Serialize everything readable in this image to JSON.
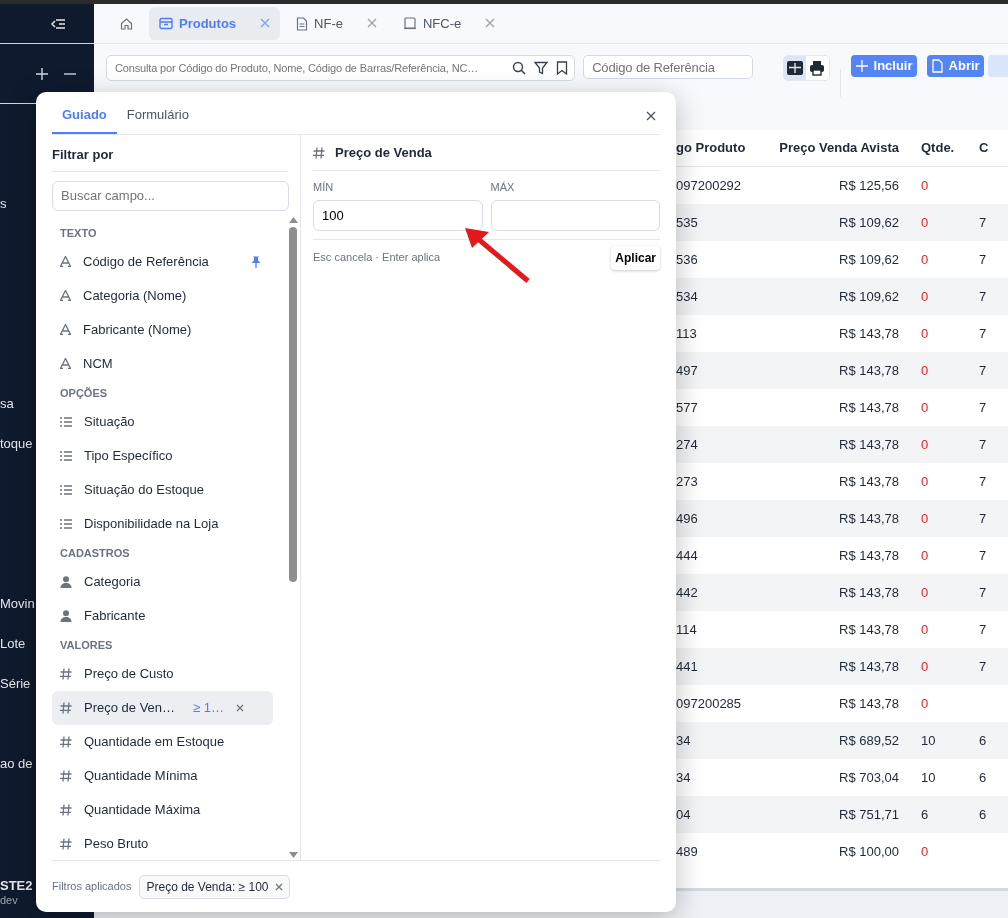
{
  "sidebar": {
    "groups": [
      [
        "s"
      ],
      [
        "sa",
        "toque"
      ],
      [
        "Movin",
        "Lote",
        "Série"
      ],
      [
        "ao de"
      ]
    ],
    "user": "STE2",
    "env": "dev"
  },
  "tabs": [
    {
      "label": "Produtos",
      "selected": true
    },
    {
      "label": "NF-e",
      "selected": false
    },
    {
      "label": "NFC-e",
      "selected": false
    }
  ],
  "toolbar": {
    "search_placeholder": "Consulta por Código do Produto, Nome, Código de Barras/Referência, NC…",
    "reference_placeholder": "Código de Referência",
    "grid_view_selected": true,
    "buttons": [
      "Incluir",
      "Abrir"
    ]
  },
  "table": {
    "columns": [
      "go Produto",
      "Preço Venda Avista",
      "Qtde.",
      "C"
    ],
    "rows": [
      {
        "code": "097200292",
        "price": "R$ 125,56",
        "qty": "0",
        "qty_alert": true
      },
      {
        "code": "535",
        "price": "R$ 109,62",
        "qty": "0",
        "qty_alert": true,
        "column_4": "7"
      },
      {
        "code": "536",
        "price": "R$ 109,62",
        "qty": "0",
        "qty_alert": true,
        "column_4": "7"
      },
      {
        "code": "534",
        "price": "R$ 109,62",
        "qty": "0",
        "qty_alert": true,
        "column_4": "7"
      },
      {
        "code": "113",
        "price": "R$ 143,78",
        "qty": "0",
        "qty_alert": true,
        "column_4": "7"
      },
      {
        "code": "497",
        "price": "R$ 143,78",
        "qty": "0",
        "qty_alert": true,
        "column_4": "7"
      },
      {
        "code": "577",
        "price": "R$ 143,78",
        "qty": "0",
        "qty_alert": true,
        "column_4": "7"
      },
      {
        "code": "274",
        "price": "R$ 143,78",
        "qty": "0",
        "qty_alert": true,
        "column_4": "7"
      },
      {
        "code": "273",
        "price": "R$ 143,78",
        "qty": "0",
        "qty_alert": true,
        "column_4": "7"
      },
      {
        "code": "496",
        "price": "R$ 143,78",
        "qty": "0",
        "qty_alert": true,
        "column_4": "7"
      },
      {
        "code": "444",
        "price": "R$ 143,78",
        "qty": "0",
        "qty_alert": true,
        "column_4": "7"
      },
      {
        "code": "442",
        "price": "R$ 143,78",
        "qty": "0",
        "qty_alert": true,
        "column_4": "7"
      },
      {
        "code": "114",
        "price": "R$ 143,78",
        "qty": "0",
        "qty_alert": true,
        "column_4": "7"
      },
      {
        "code": "441",
        "price": "R$ 143,78",
        "qty": "0",
        "qty_alert": true,
        "column_4": "7"
      },
      {
        "code": "097200285",
        "price": "R$ 143,78",
        "qty": "0",
        "qty_alert": true
      },
      {
        "code": "34",
        "price": "R$ 689,52",
        "qty": "10",
        "qty_alert": false,
        "column_4": "6"
      },
      {
        "code": "34",
        "price": "R$ 703,04",
        "qty": "10",
        "qty_alert": false,
        "column_4": "6"
      },
      {
        "code": "04",
        "price": "R$ 751,71",
        "qty": "6",
        "qty_alert": false,
        "column_4": "6"
      },
      {
        "code": "489",
        "price": "R$ 100,00",
        "qty": "0",
        "qty_alert": true
      }
    ]
  },
  "filter_modal": {
    "tabs": [
      {
        "label": "Guiado",
        "selected": true
      },
      {
        "label": "Formulário",
        "selected": false
      }
    ],
    "filter_by": "Filtrar por",
    "field_search_placeholder": "Buscar campo...",
    "groups": [
      {
        "title": "TEXTO",
        "kind": "text",
        "items": [
          {
            "label": "Código de Referência",
            "pinned": true,
            "selected": false
          },
          {
            "label": "Categoria (Nome)",
            "pinned": false,
            "selected": false
          },
          {
            "label": "Fabricante (Nome)",
            "pinned": false,
            "selected": false
          },
          {
            "label": "NCM",
            "pinned": false,
            "selected": false
          }
        ]
      },
      {
        "title": "OPÇÕES",
        "kind": "options",
        "items": [
          {
            "label": "Situação",
            "pinned": false,
            "selected": false
          },
          {
            "label": "Tipo Específico",
            "pinned": false,
            "selected": false
          },
          {
            "label": "Situação do Estoque",
            "pinned": false,
            "selected": false
          },
          {
            "label": "Disponibilidade na Loja",
            "pinned": false,
            "selected": false
          }
        ]
      },
      {
        "title": "CADASTROS",
        "kind": "registry",
        "items": [
          {
            "label": "Categoria",
            "pinned": false,
            "selected": false
          },
          {
            "label": "Fabricante",
            "pinned": false,
            "selected": false
          }
        ]
      },
      {
        "title": "VALORES",
        "kind": "value",
        "items": [
          {
            "label": "Preço de Custo",
            "pinned": false,
            "selected": false
          },
          {
            "label": "Preço de Ven…",
            "value": "≥ 1…",
            "pinned": false,
            "selected": true
          },
          {
            "label": "Quantidade em Estoque",
            "pinned": false,
            "selected": false
          },
          {
            "label": "Quantidade Mínima",
            "pinned": false,
            "selected": false
          },
          {
            "label": "Quantidade Máxima",
            "pinned": false,
            "selected": false
          },
          {
            "label": "Peso Bruto",
            "pinned": false,
            "selected": false
          }
        ]
      }
    ],
    "editor": {
      "title": "Preço de Venda",
      "min_label": "MÍN",
      "min_value": "100",
      "max_label": "MÁX",
      "hint": "Esc cancela · Enter aplica",
      "apply": "Aplicar"
    },
    "applied_label": "Filtros aplicados",
    "applied": [
      "Preço de Venda: ≥ 100"
    ]
  }
}
